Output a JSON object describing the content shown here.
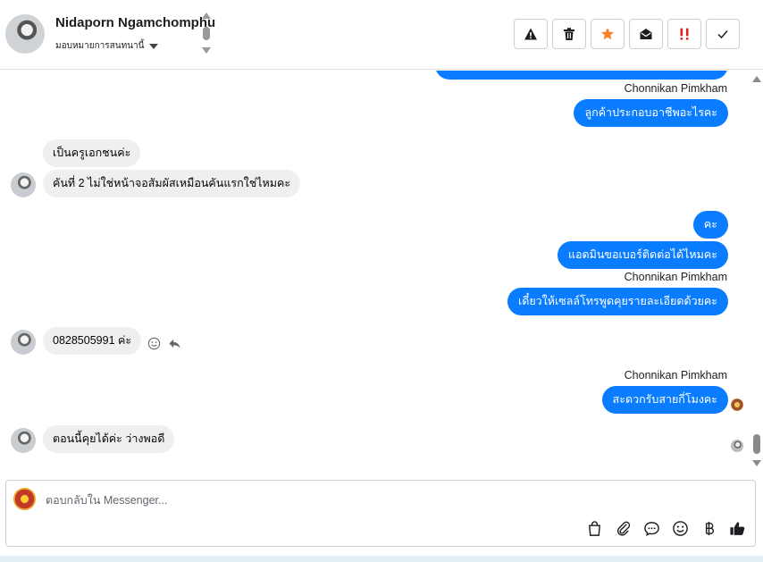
{
  "header": {
    "contact_name": "Nidaporn Ngamchomphu",
    "assign_label": "มอบหมายการสนทนานี้",
    "actions": [
      {
        "name": "report-spam-icon"
      },
      {
        "name": "trash-icon"
      },
      {
        "name": "star-icon",
        "color": "#f6822b"
      },
      {
        "name": "mark-unread-icon"
      },
      {
        "name": "important-icon",
        "color": "#e02020"
      },
      {
        "name": "check-icon"
      }
    ]
  },
  "messages": {
    "m1_sender": "Chonnikan Pimkham",
    "m1_text": "ลูกค้าประกอบอาชีพอะไรคะ",
    "m2_text": "เป็นครูเอกชนค่ะ",
    "m3_text": "คันที่ 2 ไม่ใช่หน้าจอสัมผัสเหมือนคันแรกใช่ไหมคะ",
    "m4_text": "คะ",
    "m5_text": "แอดมินขอเบอร์ติดต่อได้ไหมคะ",
    "m6_sender": "Chonnikan Pimkham",
    "m6_text": "เดี๋ยวให้เซลล์โทรพูดคุยรายละเอียดด้วยคะ",
    "m7_text": "0828505991 ค่ะ",
    "m8_sender": "Chonnikan Pimkham",
    "m8_text": "สะดวกรับสายกี่โมงคะ",
    "m9_text": "ตอนนี้คุยได้ค่ะ ว่างพอดี"
  },
  "composer": {
    "placeholder": "ตอบกลับใน Messenger...",
    "tools": [
      "shopping-bag-icon",
      "paperclip-icon",
      "chat-bubble-icon",
      "smiley-icon",
      "baht-icon",
      "thumbs-up-icon"
    ]
  },
  "colors": {
    "outgoing_bubble": "#0a7cff",
    "incoming_bubble": "#efefef"
  }
}
